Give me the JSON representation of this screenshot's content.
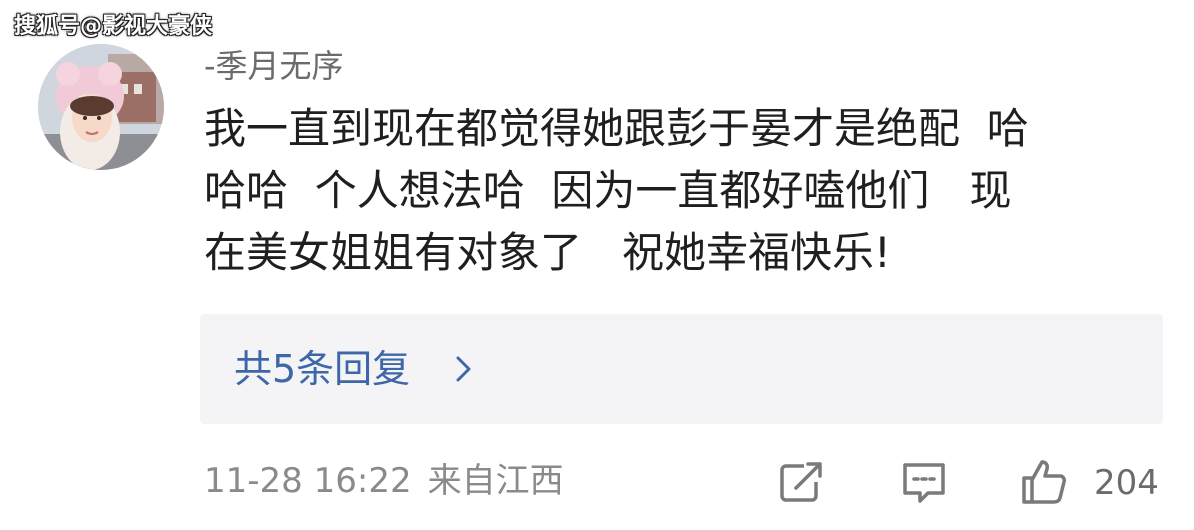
{
  "watermark": "搜狐号@影视大豪侠",
  "comment": {
    "username": "-季月无序",
    "text_lines": [
      "我一直到现在都觉得她跟彭于晏才是绝配  哈",
      "哈哈  个人想法哈  因为一直都好嗑他们   现",
      "在美女姐姐有对象了   祝她幸福快乐!"
    ],
    "replies_label": "共5条回复",
    "date": "11-28 16:22",
    "location": "来自江西",
    "like_count": "204"
  },
  "icons": {
    "avatar": "avatar-photo",
    "replies_chevron": "chevron-right-icon",
    "share": "share-icon",
    "reply": "comment-icon",
    "like": "thumbs-up-icon"
  },
  "colors": {
    "link": "#3e67a8",
    "meta": "#8a8a8a",
    "replies_bg": "#f4f4f6",
    "text": "#1f1f1f"
  }
}
